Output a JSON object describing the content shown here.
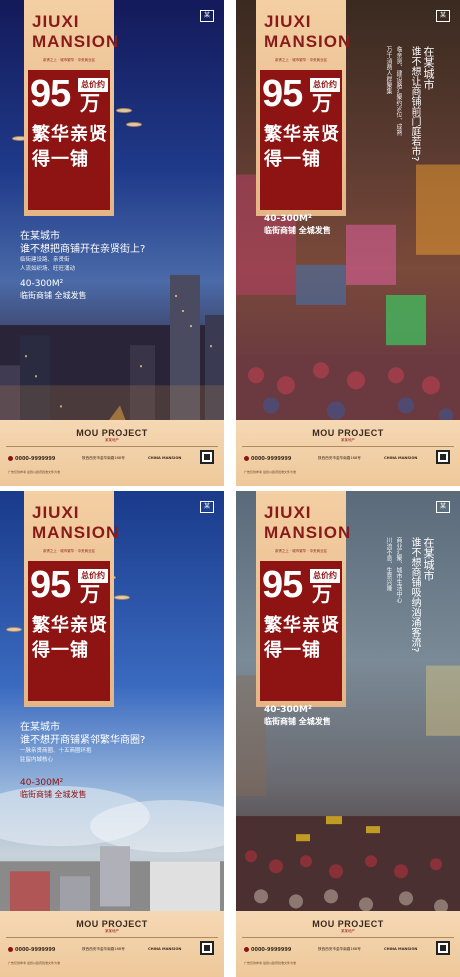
{
  "brand": {
    "name": "MOU PROJECT",
    "sub": "某某地产",
    "project_title": "JIUXI MANSION"
  },
  "price": {
    "label": "总价约",
    "amount": "95",
    "unit": "万"
  },
  "slogan": "繁华亲贤\n得一铺",
  "area": {
    "range": "40-300M²",
    "retail": "临街商铺 全城发售"
  },
  "footer": {
    "phone": "0000-9999999",
    "address": "陕西西安市金华南路168号",
    "name_en": "CHINA MANSION",
    "fine_print": "广告仅供参考 最终以政府批准文件为准"
  },
  "top_logo": "某",
  "posters": [
    {
      "id": "night-city",
      "copy_title": "在某城市",
      "copy_line": "谁不想把商铺开在亲贤街上?",
      "copy_small": [
        "临街建设路、亲贤街",
        "人流如织场、旺旺涌动"
      ],
      "tag_subtitle": "亲贤之上 · 城市繁华 · 中央商业区"
    },
    {
      "id": "shopping-street",
      "vertical_title": "在某城市",
      "vertical_line": "谁不想让商铺前门庭若市?",
      "vertical_small": [
        "临亲贤、建设路汇聚约%位、成熟",
        "万千消费人群聚集"
      ],
      "tag_subtitle": "亲贤之上 · 城市繁华 · 中央商业区"
    },
    {
      "id": "day-district",
      "copy_title": "在某城市",
      "copy_line": "谁不想开商铺紧邻繁华商圈?",
      "copy_small": [
        "一脉亲贤商圈、十五商圈环抱",
        "驻留内城核心"
      ],
      "tag_subtitle": "亲贤之上 · 城市繁华 · 中央商业区"
    },
    {
      "id": "crowd",
      "vertical_title": "在某城市",
      "vertical_line": "谁不想商铺吸纳汹涌客流?",
      "vertical_small": [
        "商业汇聚、城市生活中心",
        "川流不息、生意兴隆"
      ],
      "tag_subtitle": "亲贤之上 · 城市繁华 · 中央商业区"
    }
  ]
}
